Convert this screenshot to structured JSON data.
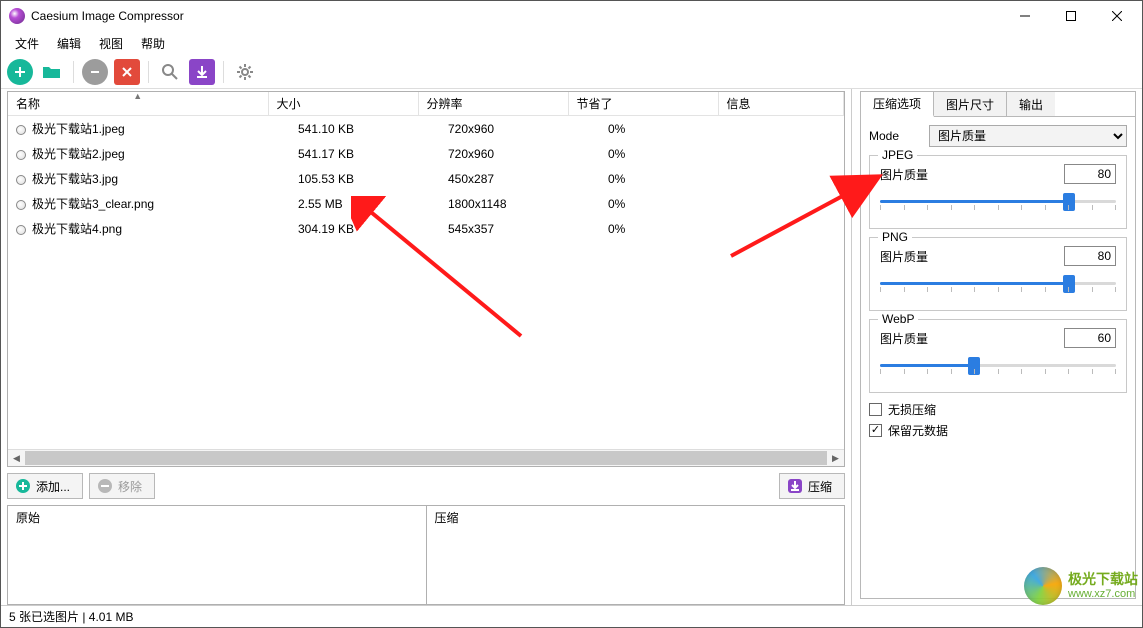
{
  "title": "Caesium Image Compressor",
  "menus": [
    "文件",
    "编辑",
    "视图",
    "帮助"
  ],
  "toolbar_icons": {
    "add": "plus-icon",
    "open": "folder-icon",
    "remove": "minus-icon",
    "delete": "trash-icon",
    "search": "search-icon",
    "download": "download-icon",
    "settings": "gear-icon"
  },
  "columns": [
    "名称",
    "大小",
    "分辨率",
    "节省了",
    "信息"
  ],
  "rows": [
    {
      "name": "极光下载站1.jpeg",
      "size": "541.10 KB",
      "res": "720x960",
      "saved": "0%",
      "info": ""
    },
    {
      "name": "极光下载站2.jpeg",
      "size": "541.17 KB",
      "res": "720x960",
      "saved": "0%",
      "info": ""
    },
    {
      "name": "极光下载站3.jpg",
      "size": "105.53 KB",
      "res": "450x287",
      "saved": "0%",
      "info": ""
    },
    {
      "name": "极光下载站3_clear.png",
      "size": "2.55 MB",
      "res": "1800x1148",
      "saved": "0%",
      "info": ""
    },
    {
      "name": "极光下载站4.png",
      "size": "304.19 KB",
      "res": "545x357",
      "saved": "0%",
      "info": ""
    }
  ],
  "buttons": {
    "add": "添加...",
    "remove": "移除",
    "compress": "压缩"
  },
  "preview": {
    "original": "原始",
    "compressed": "压缩"
  },
  "side": {
    "tabs": [
      "压缩选项",
      "图片尺寸",
      "输出"
    ],
    "mode_label": "Mode",
    "mode_value": "图片质量",
    "groups": {
      "jpeg": {
        "title": "JPEG",
        "quality_label": "图片质量",
        "quality": "80",
        "percent": 80
      },
      "png": {
        "title": "PNG",
        "quality_label": "图片质量",
        "quality": "80",
        "percent": 80
      },
      "webp": {
        "title": "WebP",
        "quality_label": "图片质量",
        "quality": "60",
        "percent": 40
      }
    },
    "lossless": "无损压缩",
    "keep_meta": "保留元数据"
  },
  "status": "5 张已选图片 | 4.01 MB",
  "watermark": {
    "line1": "极光下载站",
    "line2": "www.xz7.com"
  }
}
